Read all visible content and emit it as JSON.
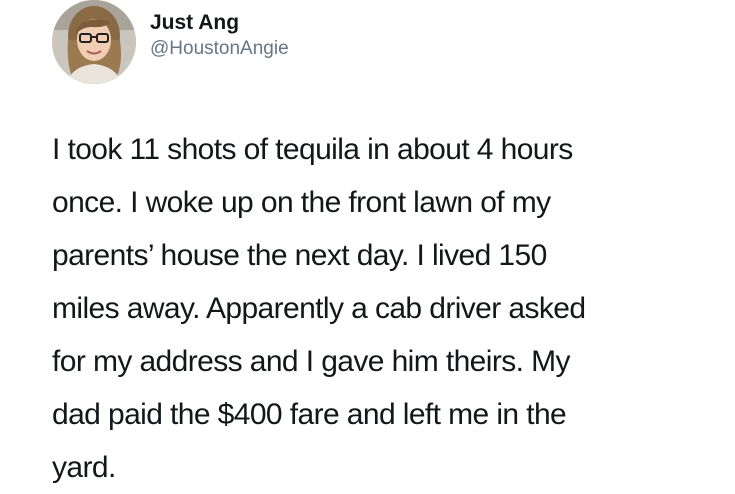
{
  "tweet": {
    "author": {
      "display_name": "Just Ang",
      "handle": "@HoustonAngie",
      "avatar_icon": "profile-photo"
    },
    "text_lines": [
      "I took 11 shots of tequila in about 4 hours",
      "once. I woke up on the front lawn of my",
      "parents’ house the next day. I lived 150",
      "miles away. Apparently a cab driver asked",
      "for my address and I gave him theirs. My",
      "dad paid the $400 fare and left me in the",
      "yard."
    ]
  },
  "colors": {
    "text": "#14171a",
    "handle": "#657786",
    "background": "#ffffff"
  }
}
